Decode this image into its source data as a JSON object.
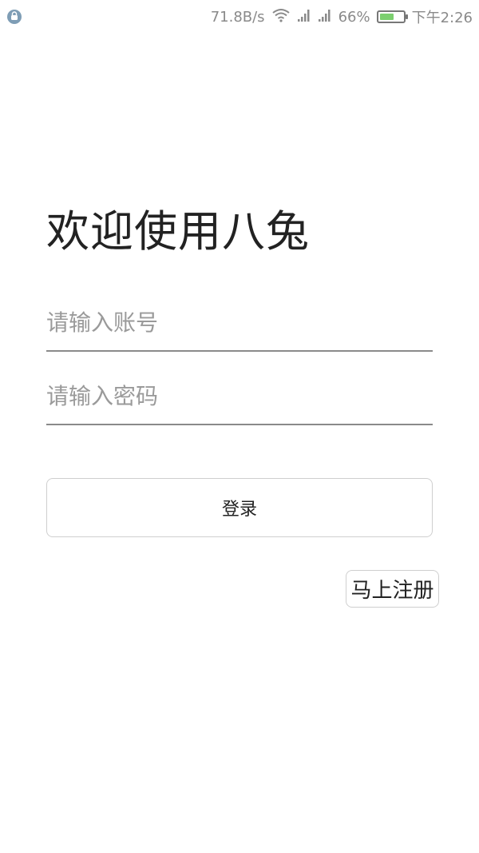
{
  "status_bar": {
    "left_icon": "app-notification-icon",
    "net_speed": "71.8B/s",
    "wifi_icon": "wifi-icon",
    "signal1_icon": "signal-icon",
    "signal2_icon": "signal-icon",
    "battery_percent": "66%",
    "battery_level": 0.66,
    "battery_color": "#7ccf6f",
    "time": "下午2:26"
  },
  "login": {
    "title": "欢迎使用八兔",
    "account_placeholder": "请输入账号",
    "account_value": "",
    "password_placeholder": "请输入密码",
    "password_value": "",
    "login_label": "登录",
    "register_label": "马上注册"
  }
}
